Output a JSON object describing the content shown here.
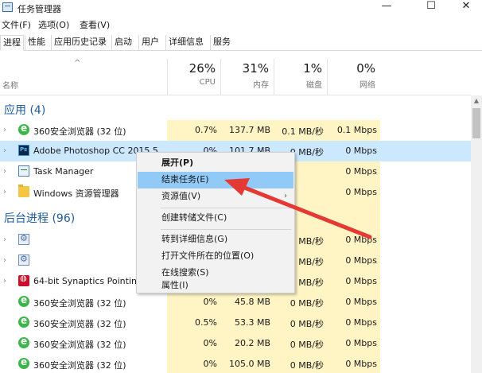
{
  "window": {
    "title": "任务管理器",
    "minimize": "—",
    "maximize": "☐",
    "close": "✕"
  },
  "menu": [
    "文件(F)",
    "选项(O)",
    "查看(V)"
  ],
  "tabs": [
    "进程",
    "性能",
    "应用历史记录",
    "启动",
    "用户",
    "详细信息",
    "服务"
  ],
  "columns": {
    "name": "名称",
    "cpu": {
      "pct": "26%",
      "label": "CPU"
    },
    "mem": {
      "pct": "31%",
      "label": "内存"
    },
    "disk": {
      "pct": "1%",
      "label": "磁盘"
    },
    "net": {
      "pct": "0%",
      "label": "网络"
    }
  },
  "groups": {
    "apps": "应用 (4)",
    "background": "后台进程 (96)"
  },
  "rows": [
    {
      "name": "360安全浏览器 (32 位)",
      "cpu": "0.7%",
      "mem": "137.7 MB",
      "disk": "0.1 MB/秒",
      "net": "0.1 Mbps",
      "icon": "browser-icon"
    },
    {
      "name": "Adobe Photoshop CC 2015.5",
      "cpu": "0%",
      "mem": "101.7 MB",
      "disk": "0 MB/秒",
      "net": "0 Mbps",
      "icon": "photoshop-icon"
    },
    {
      "name": "Task Manager",
      "cpu": "",
      "mem": "",
      "disk": "",
      "net": "0 Mbps",
      "icon": "task-manager-icon"
    },
    {
      "name": "Windows 资源管理器",
      "cpu": "",
      "mem": "",
      "disk": "",
      "net": "0 Mbps",
      "icon": "folder-icon"
    },
    {
      "name": "",
      "cpu": "",
      "mem": "",
      "disk": "0 MB/秒",
      "net": "0 Mbps",
      "icon": "service-icon"
    },
    {
      "name": "",
      "cpu": "",
      "mem": "",
      "disk": "0 MB/秒",
      "net": "0 Mbps",
      "icon": "service-icon"
    },
    {
      "name": "64-bit Synaptics Pointing",
      "cpu": "",
      "mem": "",
      "disk": "0 MB/秒",
      "net": "0 Mbps",
      "icon": "synaptics-icon"
    },
    {
      "name": "360安全浏览器 (32 位)",
      "cpu": "0%",
      "mem": "45.8 MB",
      "disk": "0 MB/秒",
      "net": "0 Mbps",
      "icon": "browser-icon"
    },
    {
      "name": "360安全浏览器 (32 位)",
      "cpu": "0.5%",
      "mem": "53.3 MB",
      "disk": "0 MB/秒",
      "net": "0 Mbps",
      "icon": "browser-icon"
    },
    {
      "name": "360安全浏览器 (32 位)",
      "cpu": "0%",
      "mem": "20.2 MB",
      "disk": "0 MB/秒",
      "net": "0 Mbps",
      "icon": "browser-icon"
    },
    {
      "name": "360安全浏览器 (32 位)",
      "cpu": "0%",
      "mem": "105.0 MB",
      "disk": "0 MB/秒",
      "net": "0 Mbps",
      "icon": "browser-icon"
    }
  ],
  "context_menu": {
    "expand": "展开(P)",
    "end_task": "结束任务(E)",
    "resource_values": "资源值(V)",
    "create_dump": "创建转储文件(C)",
    "go_to_details": "转到详细信息(G)",
    "open_file_location": "打开文件所在的位置(O)",
    "search_online": "在线搜索(S)",
    "properties": "属性(I)"
  },
  "colors": {
    "heat": "#fff4c4",
    "selected": "#cce8ff",
    "menu_hover": "#91c9f7",
    "arrow": "#e53935",
    "group": "#1c5a9c"
  }
}
